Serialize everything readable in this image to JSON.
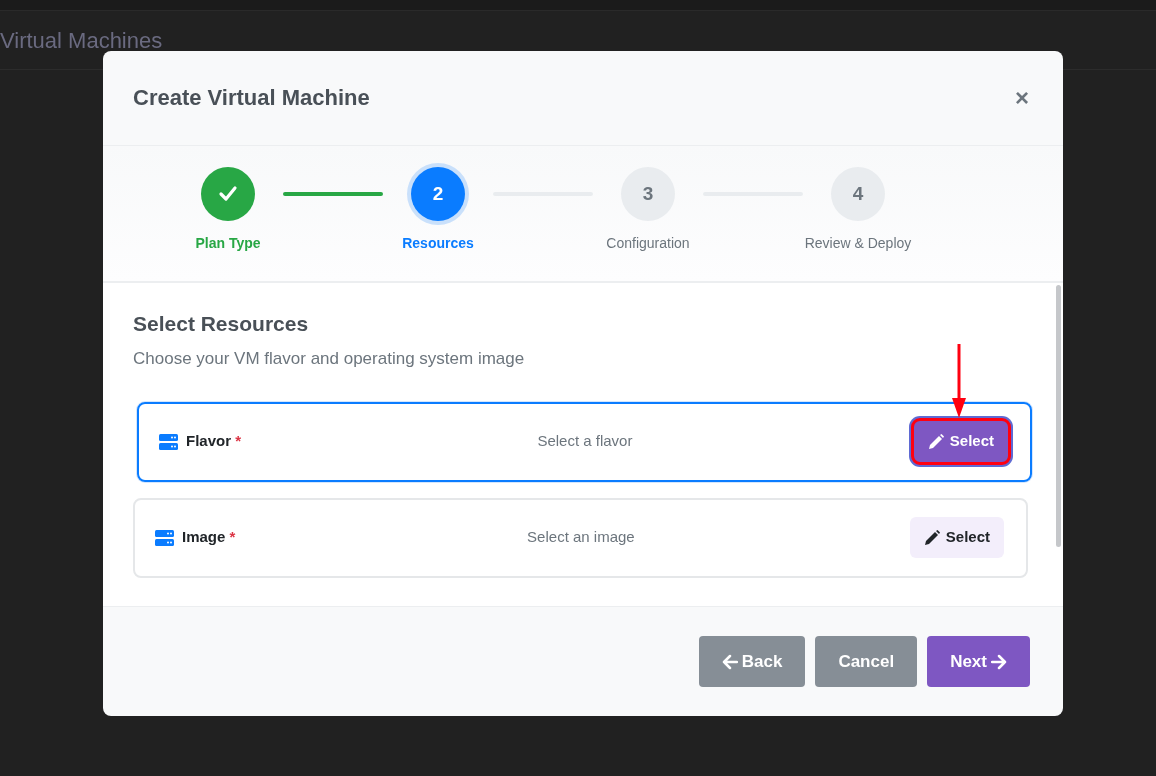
{
  "page": {
    "title": "Virtual Machines"
  },
  "dialog": {
    "title": "Create Virtual Machine",
    "close": "×"
  },
  "steps": [
    {
      "label": "Plan Type",
      "completed": true,
      "selected": false
    },
    {
      "number": "2",
      "label": "Resources",
      "completed": false,
      "selected": true
    },
    {
      "number": "3",
      "label": "Configuration",
      "completed": false,
      "selected": false
    },
    {
      "number": "4",
      "label": "Review & Deploy",
      "completed": false,
      "selected": false
    }
  ],
  "section": {
    "title": "Select Resources",
    "subtitle": "Choose your VM flavor and operating system image"
  },
  "resources": [
    {
      "label": "Flavor",
      "required_mark": "*",
      "placeholder": "Select a flavor",
      "button": "Select",
      "focused": true,
      "annotated": true
    },
    {
      "label": "Image",
      "required_mark": "*",
      "placeholder": "Select an image",
      "button": "Select",
      "focused": false,
      "annotated": false
    }
  ],
  "footer": [
    {
      "label": "Back",
      "kind": "back"
    },
    {
      "label": "Cancel",
      "kind": "cancel"
    },
    {
      "label": "Next",
      "kind": "next"
    }
  ]
}
